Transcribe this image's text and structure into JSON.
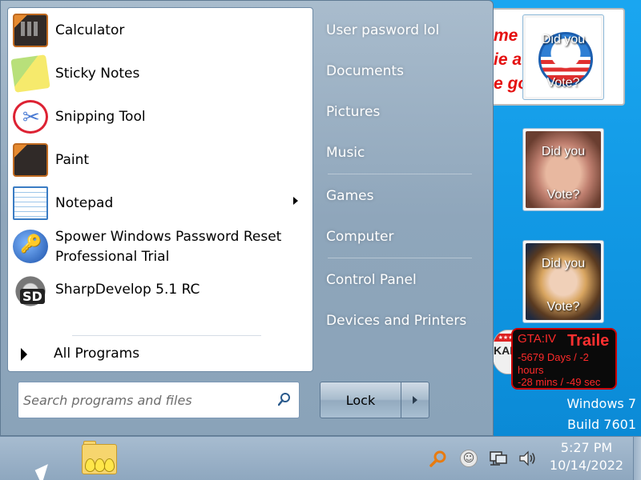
{
  "desktop": {
    "banner_lines": [
      "me a good",
      "ie a",
      "e go"
    ],
    "gadgets": [
      {
        "line1": "Did you",
        "line2": "Vote?"
      },
      {
        "line1": "Did you",
        "line2": "Vote?"
      },
      {
        "line1": "Did you",
        "line2": "Vote?"
      }
    ],
    "flag_widget": {
      "stars": "★★★",
      "text": "KAB"
    },
    "gta": {
      "title": "GTA:IV",
      "trailer": "Traile",
      "line1": "-5679 Days / -2",
      "line2": "hours",
      "line3": "-28 mins / -49 sec"
    },
    "watermark": {
      "line1": "Windows 7",
      "line2": "Build 7601"
    }
  },
  "start_menu": {
    "programs": [
      {
        "label": "Calculator",
        "icon": "calculator-icon"
      },
      {
        "label": "Sticky Notes",
        "icon": "sticky-notes-icon"
      },
      {
        "label": "Snipping Tool",
        "icon": "snipping-tool-icon"
      },
      {
        "label": "Paint",
        "icon": "paint-icon"
      },
      {
        "label": "Notepad",
        "icon": "notepad-icon"
      },
      {
        "label": "Spower Windows Password Reset",
        "label2": "Professional Trial",
        "icon": "key-icon"
      },
      {
        "label": "SharpDevelop 5.1 RC",
        "icon": "sharpdevelop-icon"
      }
    ],
    "all_programs": "All Programs",
    "search": {
      "placeholder": "Search programs and files",
      "value": ""
    },
    "right_items": [
      "User pasword lol",
      "Documents",
      "Pictures",
      "Music",
      "Games",
      "Computer",
      "Control Panel",
      "Devices and Printers"
    ],
    "lock_label": "Lock"
  },
  "taskbar": {
    "clock_time": "5:27 PM",
    "clock_date": "10/14/2022",
    "tray_icons": [
      "search-icon",
      "smiley-icon",
      "network-icon",
      "volume-icon"
    ]
  }
}
